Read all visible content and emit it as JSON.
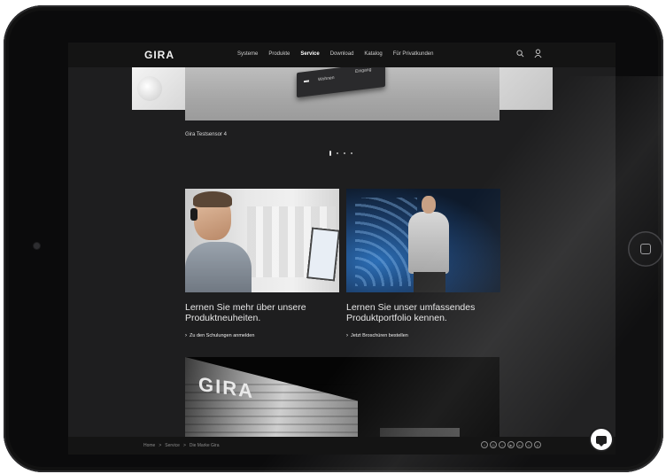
{
  "nav": {
    "logo": "GIRA",
    "items": [
      {
        "label": "Systeme"
      },
      {
        "label": "Produkte"
      },
      {
        "label": "Service",
        "active": true
      },
      {
        "label": "Download"
      },
      {
        "label": "Katalog"
      },
      {
        "label": "Für Privatkunden"
      }
    ]
  },
  "hero": {
    "device_label_1": "Wohnen",
    "device_label_2": "Eingang",
    "caption": "Gira Testsensor 4"
  },
  "cards": [
    {
      "title": "Lernen Sie mehr über unsere Produktneuheiten.",
      "link": "Zu den Schulungen anmelden"
    },
    {
      "title": "Lernen Sie unser umfassendes Produktportfolio kennen.",
      "link": "Jetzt Broschüren bestellen"
    }
  ],
  "banner": {
    "word": "GIRA"
  },
  "footer": {
    "breadcrumb": [
      "Home",
      ">",
      "Service",
      ">",
      "Die Marke Gira"
    ],
    "social_icons": [
      "facebook-icon",
      "instagram-icon",
      "twitter-icon",
      "youtube-icon",
      "linkedin-icon",
      "xing-icon",
      "pinterest-icon"
    ]
  },
  "icons": {
    "search": "search-icon",
    "user": "user-icon",
    "chat": "chat-icon",
    "home_button": "home-button-icon"
  },
  "colors": {
    "page_bg": "#1e1e1f",
    "nav_bg": "#141414",
    "text": "#e6e6e6"
  }
}
